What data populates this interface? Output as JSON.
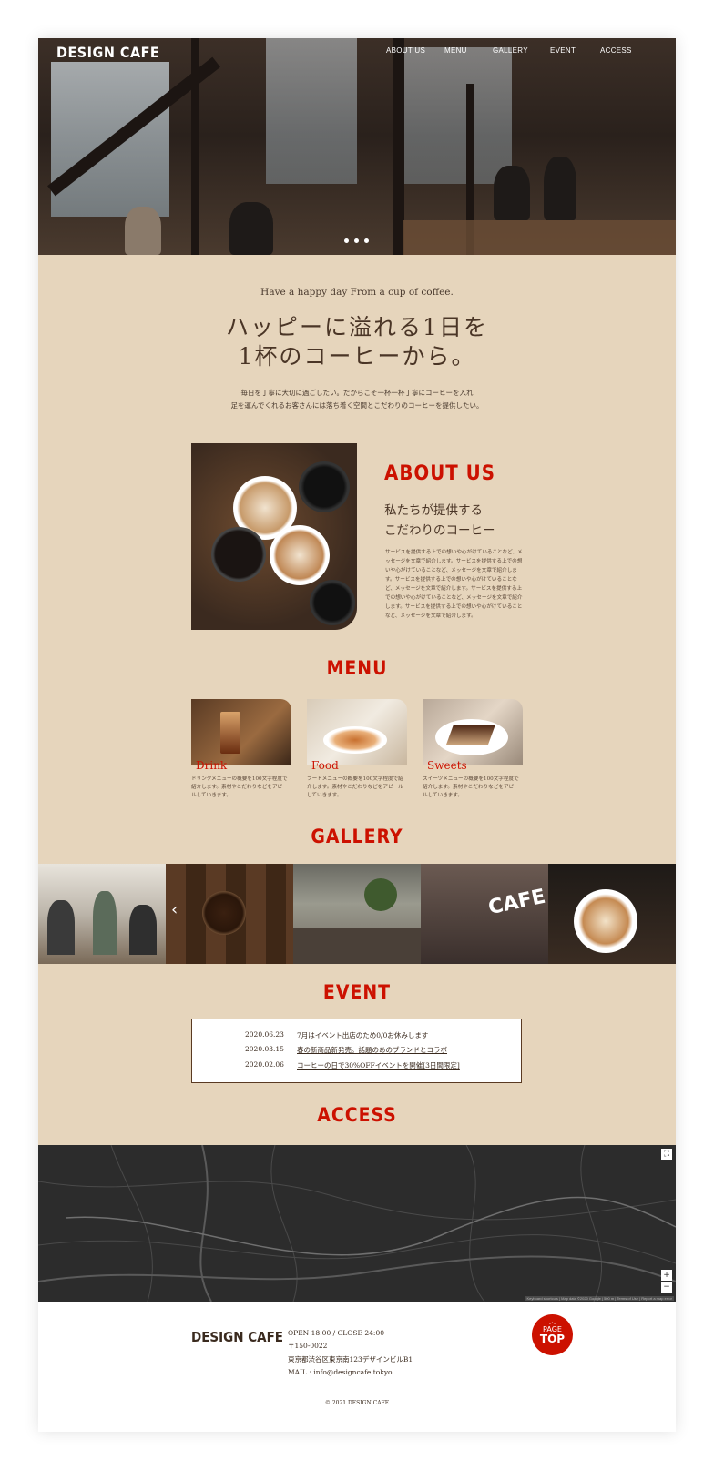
{
  "header": {
    "logo": "DESIGN CAFE",
    "nav": [
      "ABOUT US",
      "MENU",
      "GALLERY",
      "EVENT",
      "ACCESS"
    ]
  },
  "hero": {
    "slide_count": 3
  },
  "intro": {
    "tagline": "Have a happy day From a cup of coffee.",
    "headline_line1": "ハッピーに溢れる1日を",
    "headline_line2": "1杯のコーヒーから。",
    "lead_line1": "毎日を丁寧に大切に過ごしたい。だからこそ一杯一杯丁寧にコーヒーを入れ",
    "lead_line2": "足を運んでくれるお客さんには落ち着く空間とこだわりのコーヒーを提供したい。"
  },
  "about": {
    "title": "ABOUT US",
    "subtitle_line1": "私たちが提供する",
    "subtitle_line2": "こだわりのコーヒー",
    "body": "サービスを提供する上での想いや心がけていることなど、メッセージを文章で紹介します。サービスを提供する上での想いや心がけていることなど、メッセージを文章で紹介します。サービスを提供する上での想いや心がけていることなど、メッセージを文章で紹介します。サービスを提供する上での想いや心がけていることなど、メッセージを文章で紹介します。サービスを提供する上での想いや心がけていることなど、メッセージを文章で紹介します。"
  },
  "menu": {
    "title": "MENU",
    "items": [
      {
        "name": "Drink",
        "desc": "ドリンクメニューの概要を100文字程度で紹介します。素材やこだわりなどをアピールしていきます。"
      },
      {
        "name": "Food",
        "desc": "フードメニューの概要を100文字程度で紹介します。素材やこだわりなどをアピールしていきます。"
      },
      {
        "name": "Sweets",
        "desc": "スイーツメニューの概要を100文字程度で紹介します。素材やこだわりなどをアピールしていきます。"
      }
    ]
  },
  "gallery": {
    "title": "GALLERY",
    "sign_text": "CAFE"
  },
  "event": {
    "title": "EVENT",
    "items": [
      {
        "date": "2020.06.23",
        "title": "7月はイベント出店のため0/0お休みします"
      },
      {
        "date": "2020.03.15",
        "title": "春の新商品新発売。話題のあのブランドとコラボ"
      },
      {
        "date": "2020.02.06",
        "title": "コーヒーの日で30%OFFイベントを開催[3日間限定]"
      }
    ]
  },
  "access": {
    "title": "ACCESS",
    "map_attribution": "Keyboard shortcuts | Map data ©2020 Google | 500 m | Terms of Use | Report a map error"
  },
  "footer": {
    "logo": "DESIGN CAFE",
    "hours": "OPEN 18:00 / CLOSE 24:00",
    "zip": "〒150-0022",
    "address": "東京都渋谷区東京南123デザインビルB1",
    "mail": "MAIL : info@designcafe.tokyo",
    "pagetop_line1": "PAGE",
    "pagetop_line2": "TOP",
    "copyright": "© 2021 DESIGN CAFE"
  },
  "colors": {
    "accent": "#cc1100",
    "background": "#e6d5bc",
    "text_dark": "#4a3526"
  }
}
